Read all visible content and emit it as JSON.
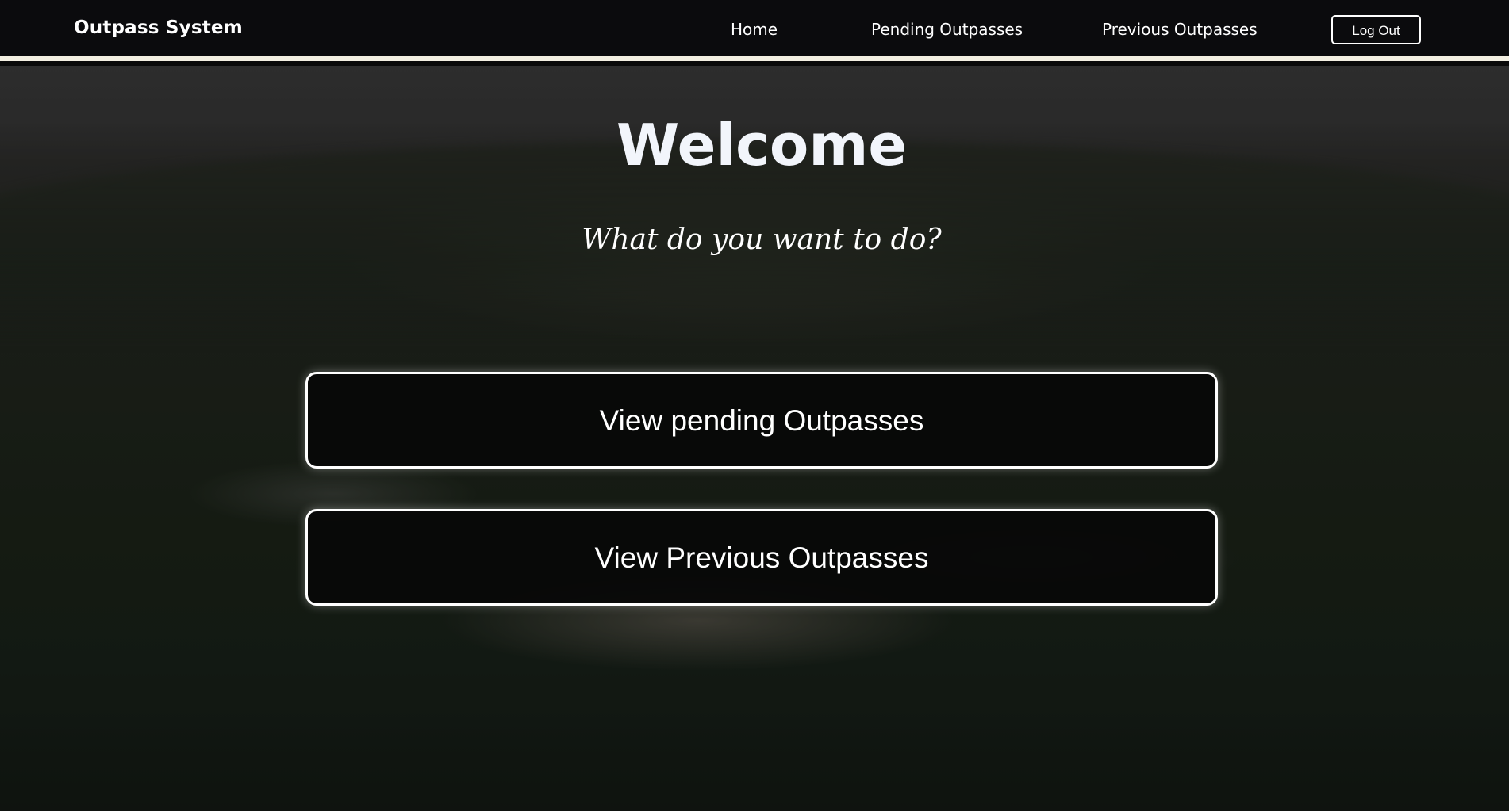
{
  "navbar": {
    "brand": "Outpass System",
    "links": [
      {
        "label": "Home"
      },
      {
        "label": "Pending Outpasses"
      },
      {
        "label": "Previous Outpasses"
      }
    ],
    "logout_label": "Log Out"
  },
  "main": {
    "title": "Welcome",
    "subtitle": "What do you want to do?",
    "actions": [
      {
        "label": "View pending Outpasses"
      },
      {
        "label": "View Previous Outpasses"
      }
    ]
  },
  "colors": {
    "navbar_bg": "#0b0b0d",
    "navbar_border": "#f3efe2",
    "button_bg": "#080808",
    "text": "#ffffff"
  }
}
